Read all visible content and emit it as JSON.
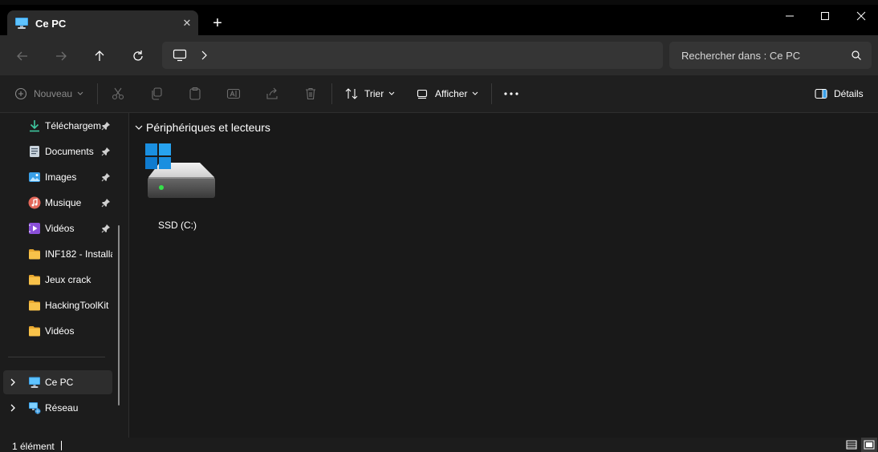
{
  "window": {
    "tab_title": "Ce PC",
    "new_tab_symbol": "+",
    "close_tab_symbol": "✕"
  },
  "address": {
    "location_icon": "pc-icon",
    "separator": "›"
  },
  "search": {
    "placeholder": "Rechercher dans : Ce PC"
  },
  "toolbar": {
    "new_label": "Nouveau",
    "sort_label": "Trier",
    "view_label": "Afficher",
    "details_label": "Détails"
  },
  "sidebar": {
    "items": [
      {
        "label": "Téléchargem",
        "icon": "download-icon",
        "pinned": true
      },
      {
        "label": "Documents",
        "icon": "documents-icon",
        "pinned": true
      },
      {
        "label": "Images",
        "icon": "images-icon",
        "pinned": true
      },
      {
        "label": "Musique",
        "icon": "music-icon",
        "pinned": true
      },
      {
        "label": "Vidéos",
        "icon": "videos-icon",
        "pinned": true
      },
      {
        "label": "INF182 - Installa",
        "icon": "folder-icon",
        "pinned": false
      },
      {
        "label": "Jeux crack",
        "icon": "folder-icon",
        "pinned": false
      },
      {
        "label": "HackingToolKit",
        "icon": "folder-icon",
        "pinned": false
      },
      {
        "label": "Vidéos",
        "icon": "folder-icon",
        "pinned": false
      }
    ],
    "this_pc": "Ce PC",
    "network": "Réseau"
  },
  "content": {
    "group_title": "Périphériques et lecteurs",
    "drives": [
      {
        "label": "SSD (C:)",
        "icon": "windows-drive-icon"
      }
    ]
  },
  "status": {
    "item_count": "1 élément"
  },
  "colors": {
    "accent": "#0078d4",
    "folder": "#f8c24a",
    "window_bg": "#191919"
  }
}
